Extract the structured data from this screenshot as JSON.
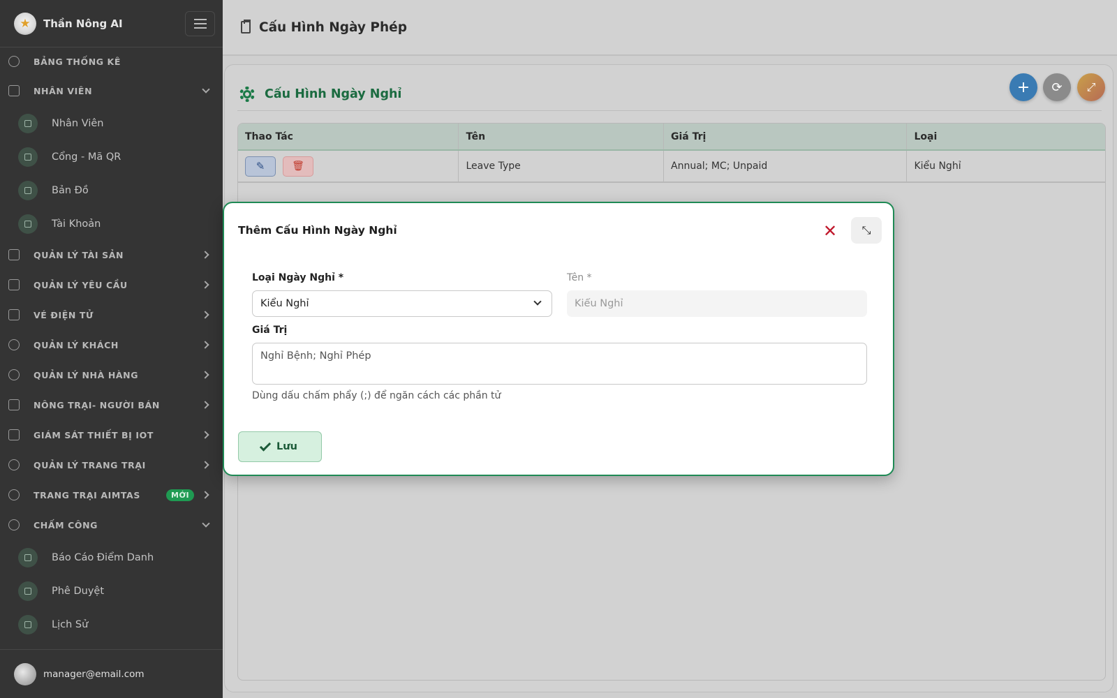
{
  "sidebar": {
    "brand": "Thần Nông AI",
    "items": [
      {
        "label": "BẢNG THỐNG KÊ"
      },
      {
        "label": "NHÂN VIÊN"
      },
      {
        "label": "QUẢN LÝ TÀI SẢN"
      },
      {
        "label": "QUẢN LÝ YÊU CẦU"
      },
      {
        "label": "VÉ ĐIỆN TỬ"
      },
      {
        "label": "QUẢN LÝ KHÁCH"
      },
      {
        "label": "QUẢN LÝ NHÀ HÀNG"
      },
      {
        "label": "NÔNG TRẠI- NGƯỜI BÁN"
      },
      {
        "label": "GIÁM SÁT THIẾT BỊ IOT"
      },
      {
        "label": "QUẢN LÝ TRANG TRẠI"
      },
      {
        "label": "TRANG TRẠI AIMTAS",
        "badge": "MỚI"
      },
      {
        "label": "CHẤM CÔNG"
      }
    ],
    "staff_subitems": [
      "Nhân Viên",
      "Cổng - Mã QR",
      "Bản Đồ",
      "Tài Khoản"
    ],
    "attendance_subitems": [
      "Báo Cáo Điểm Danh",
      "Phê Duyệt",
      "Lịch Sử"
    ],
    "user_email": "manager@email.com"
  },
  "topbar": {
    "title": "Cấu Hình Ngày Phép"
  },
  "card": {
    "title": "Cấu Hình Ngày Nghỉ",
    "fab_add": "+",
    "fab_refresh": "⟳",
    "fab_expand": "⤢"
  },
  "table": {
    "headers": [
      "Thao Tác",
      "Tên",
      "Giá Trị",
      "Loại"
    ],
    "rows": [
      {
        "name": "Leave Type",
        "value": "Annual; MC; Unpaid",
        "type": "Kiểu Nghỉ"
      }
    ]
  },
  "modal": {
    "title": "Thêm Cấu Hình Ngày Nghỉ",
    "close": "✕",
    "expand": "⤡",
    "type_label": "Loại Ngày Nghỉ *",
    "type_value": "Kiểu Nghỉ",
    "name_label": "Tên *",
    "name_value": "Kiểu Nghỉ",
    "value_label": "Giá Trị",
    "value_text": "Nghỉ Bệnh; Nghỉ Phép",
    "hint": "Dùng dấu chấm phẩy (;) để ngăn cách các phần tử",
    "save_label": "Lưu"
  },
  "colors": {
    "accent": "#1f8a55",
    "sidebar_bg": "#343434",
    "danger": "#c0172b",
    "badge": "#1f9a52"
  }
}
